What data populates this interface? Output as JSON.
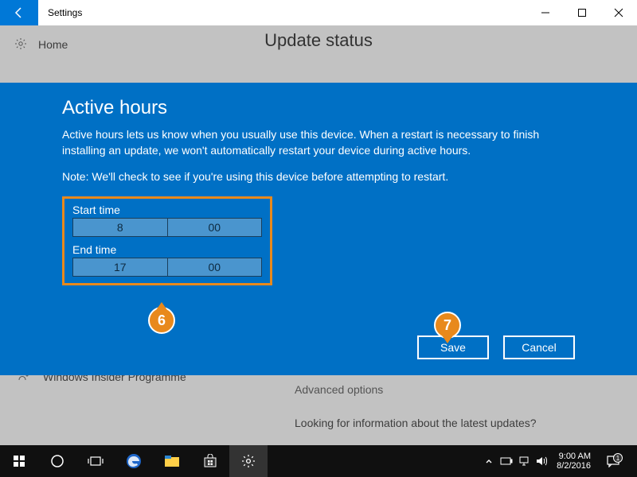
{
  "titlebar": {
    "title": "Settings"
  },
  "nav": {
    "home": "Home",
    "page_title": "Update status"
  },
  "background": {
    "insider": "Windows Insider Programme",
    "advanced": "Advanced options",
    "looking": "Looking for information about the latest updates?"
  },
  "modal": {
    "heading": "Active hours",
    "desc": "Active hours lets us know when you usually use this device. When a restart is necessary to finish installing an update, we won't automatically restart your device during active hours.",
    "note": "Note: We'll check to see if you're using this device before attempting to restart.",
    "start_label": "Start time",
    "start_hour": "8",
    "start_min": "00",
    "end_label": "End time",
    "end_hour": "17",
    "end_min": "00",
    "save": "Save",
    "cancel": "Cancel"
  },
  "callouts": {
    "six": "6",
    "seven": "7"
  },
  "tray": {
    "time": "9:00 AM",
    "date": "8/2/2016",
    "notif_count": "1"
  }
}
